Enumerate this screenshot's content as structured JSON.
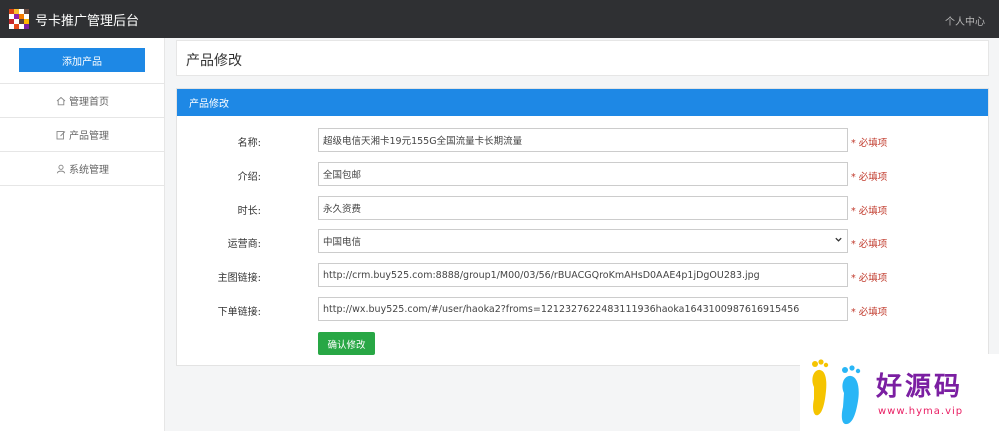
{
  "header": {
    "app_title": "号卡推广管理后台",
    "user_center": "个人中心"
  },
  "sidebar": {
    "add_button": "添加产品",
    "items": [
      {
        "label": "管理首页",
        "icon": "home-icon"
      },
      {
        "label": "产品管理",
        "icon": "edit-icon"
      },
      {
        "label": "系统管理",
        "icon": "user-icon"
      }
    ]
  },
  "page": {
    "title": "产品修改"
  },
  "card": {
    "title": "产品修改"
  },
  "form": {
    "required_text": "* 必填项",
    "name": {
      "label": "名称:",
      "value": "超级电信天湘卡19元155G全国流量卡长期流量"
    },
    "intro": {
      "label": "介绍:",
      "value": "全国包邮"
    },
    "duration": {
      "label": "时长:",
      "value": "永久资费"
    },
    "carrier": {
      "label": "运营商:",
      "value": "中国电信"
    },
    "image_link": {
      "label": "主图链接:",
      "value": "http://crm.buy525.com:8888/group1/M00/03/56/rBUACGQroKmAHsD0AAE4p1jDgOU283.jpg"
    },
    "order_link": {
      "label": "下单链接:",
      "value": "http://wx.buy525.com/#/user/haoka2?froms=1212327622483111936haoka1643100987616915456"
    },
    "submit": "确认修改"
  },
  "watermark": {
    "text": "好源码",
    "url": "www.hyma.vip"
  },
  "colors": {
    "topbar": "#2f3033",
    "primary": "#1e88e5",
    "success": "#28a745",
    "required": "#c0392b"
  }
}
